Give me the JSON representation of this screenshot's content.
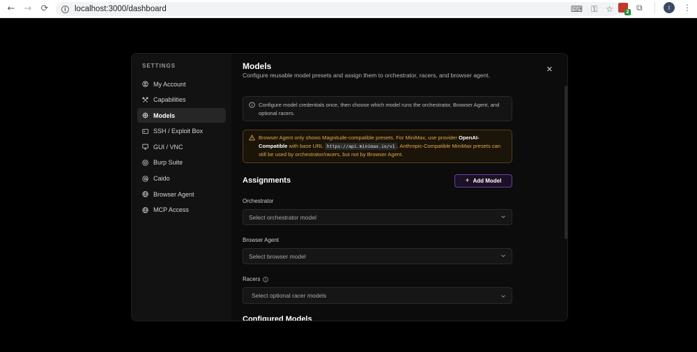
{
  "browser": {
    "url": "localhost:3000/dashboard",
    "extension_badge": "2",
    "profile_initial": "I"
  },
  "modal": {
    "sidebar": {
      "title": "SETTINGS",
      "items": [
        {
          "label": "My Account",
          "icon": "user-icon",
          "active": false
        },
        {
          "label": "Capabilities",
          "icon": "tools-icon",
          "active": false
        },
        {
          "label": "Models",
          "icon": "cpu-icon",
          "active": true
        },
        {
          "label": "SSH / Exploit Box",
          "icon": "terminal-icon",
          "active": false
        },
        {
          "label": "GUI / VNC",
          "icon": "monitor-icon",
          "active": false
        },
        {
          "label": "Burp Suite",
          "icon": "bug-icon",
          "active": false
        },
        {
          "label": "Caido",
          "icon": "at-icon",
          "active": false
        },
        {
          "label": "Browser Agent",
          "icon": "globe-icon",
          "active": false
        },
        {
          "label": "MCP Access",
          "icon": "globe-icon",
          "active": false
        }
      ]
    },
    "header": {
      "title": "Models",
      "subtitle": "Configure reusable model presets and assign them to orchestrator, racers, and browser agent."
    },
    "info": {
      "text": "Configure model credentials once, then choose which model runs the orchestrator, Browser Agent, and optional racers."
    },
    "warning": {
      "part1": "Browser Agent only shows Magnitude-compatible presets. For MiniMax, use provider ",
      "provider": "OpenAI-Compatible",
      "part2": " with base URL ",
      "base_url": "https://api.minimax.io/v1",
      "part3": ". Anthropic-Compatible MiniMax presets can still be used by orchestrator/racers, but not by Browser Agent."
    },
    "assignments": {
      "heading": "Assignments",
      "add_button": "Add Model",
      "orchestrator_label": "Orchestrator",
      "orchestrator_placeholder": "Select orchestrator model",
      "browser_label": "Browser Agent",
      "browser_placeholder": "Select browser model",
      "racers_label": "Racers",
      "racers_placeholder": "Select optional racer models"
    },
    "configured_heading": "Configured Models"
  }
}
